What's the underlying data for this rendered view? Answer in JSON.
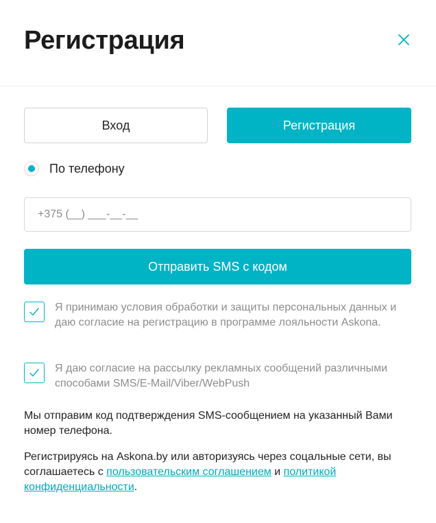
{
  "header": {
    "title": "Регистрация",
    "close_icon": "close-icon"
  },
  "tabs": {
    "login_label": "Вход",
    "register_label": "Регистрация",
    "active": "register"
  },
  "method": {
    "label": "По телефону",
    "selected": true
  },
  "phone_input": {
    "placeholder": "+375 (__) ___-__-__",
    "value": ""
  },
  "send_button": {
    "label": "Отправить SMS с кодом"
  },
  "consents": [
    {
      "checked": true,
      "text": "Я принимаю условия обработки и защиты персональных данных и даю согласие на регистрацию в программе лояльности Askona."
    },
    {
      "checked": true,
      "text": "Я даю согласие на рассылку рекламных сообщений различными способами SMS/E-Mail/Viber/WebPush"
    }
  ],
  "sms_note": "Мы отправим код подтверждения SMS-сообщением на указанный Вами номер телефона.",
  "agreement": {
    "prefix": "Регистрируясь на Askona.by или авторизуясь через соцальные сети, вы соглашаетесь с ",
    "link1": "пользовательским соглашением",
    "middle": " и ",
    "link2": "политикой конфиденциальности",
    "suffix": "."
  },
  "colors": {
    "accent": "#00b3c5",
    "link": "#00a9bd"
  }
}
